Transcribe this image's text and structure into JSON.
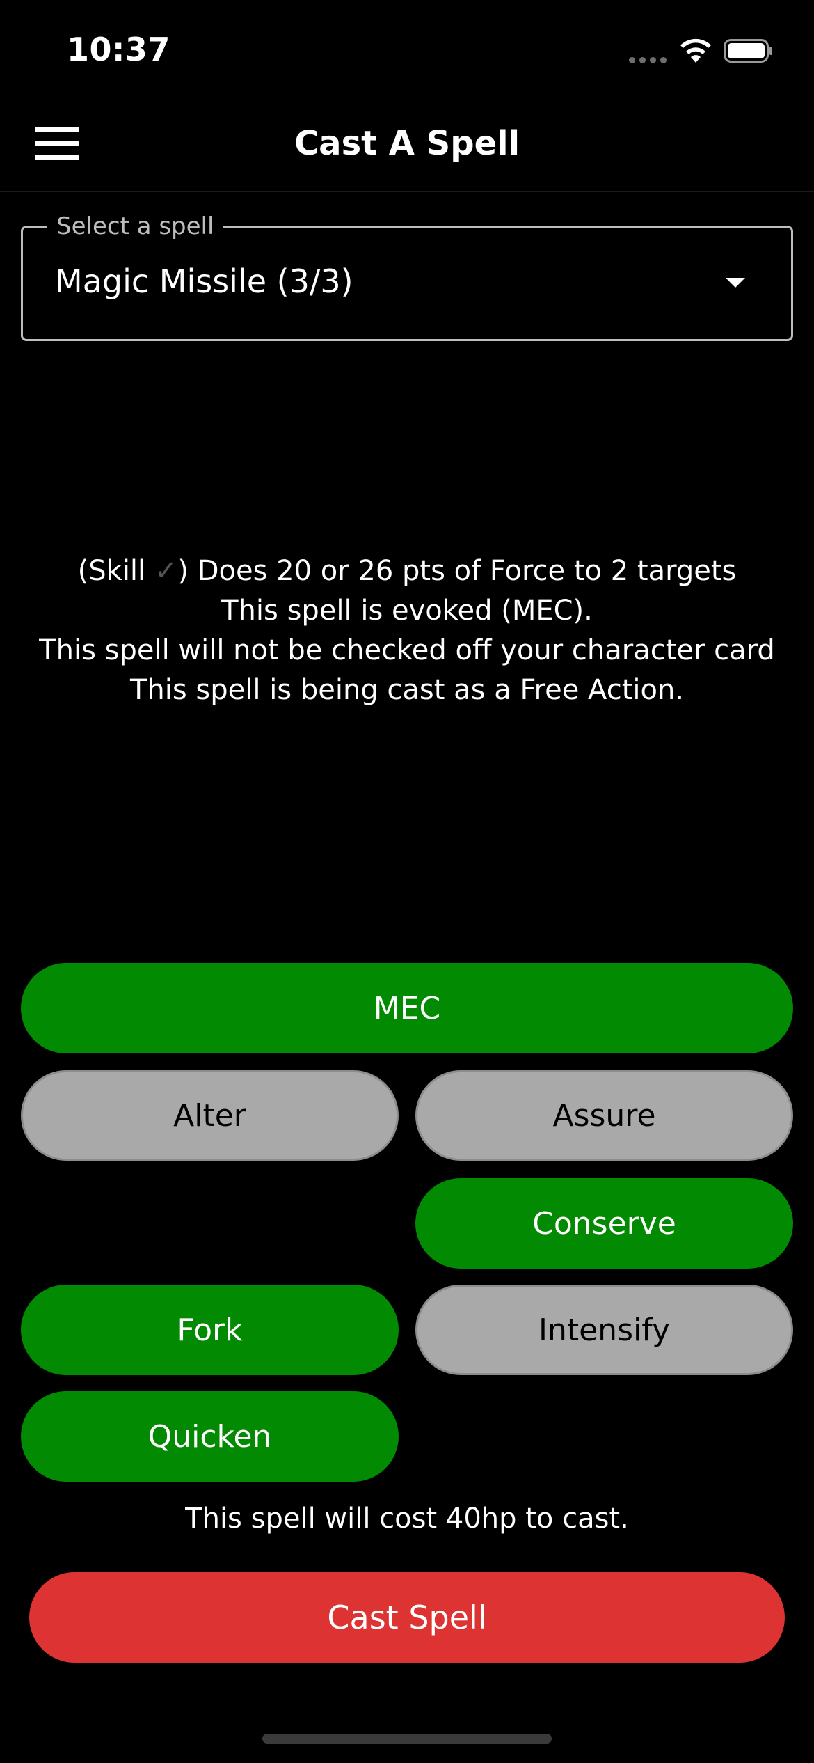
{
  "status_bar": {
    "time": "10:37"
  },
  "nav": {
    "title": "Cast A Spell"
  },
  "spell_select": {
    "label": "Select a spell",
    "value": "Magic Missile (3/3)"
  },
  "description": {
    "line1_prefix": "(Skill ",
    "line1_check": "✓",
    "line1_suffix": ") Does 20 or 26 pts of Force to 2 targets",
    "line2": "This spell is evoked (MEC).",
    "line3": "This spell will not be checked off your character card",
    "line4": "This spell is being cast as a Free Action."
  },
  "modifiers": {
    "mec": {
      "label": "MEC",
      "state": "on"
    },
    "alter": {
      "label": "Alter",
      "state": "off"
    },
    "assure": {
      "label": "Assure",
      "state": "off"
    },
    "conserve": {
      "label": "Conserve",
      "state": "on"
    },
    "fork": {
      "label": "Fork",
      "state": "on"
    },
    "intensify": {
      "label": "Intensify",
      "state": "off"
    },
    "quicken": {
      "label": "Quicken",
      "state": "on"
    }
  },
  "colors": {
    "on": "#028a02",
    "off": "#a9a9a9",
    "cast": "#dd3333",
    "background": "#000000"
  },
  "cost_text": "This spell will cost 40hp to cast.",
  "cast_button": {
    "label": "Cast Spell"
  }
}
